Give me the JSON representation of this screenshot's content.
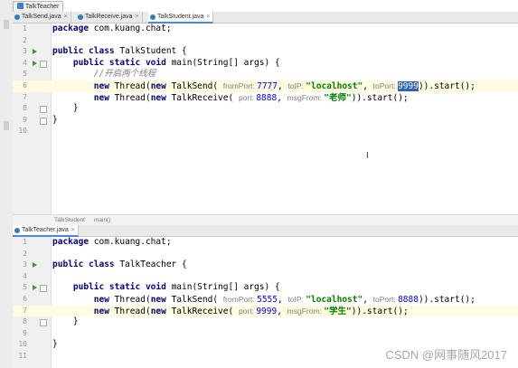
{
  "window": {
    "title": "TalkTeacher"
  },
  "top_tabs": [
    {
      "label": "TalkSend.java",
      "active": false
    },
    {
      "label": "TalkReceive.java",
      "active": false
    },
    {
      "label": "TalkStudent.java",
      "active": true
    }
  ],
  "top_editor": {
    "lines": [
      {
        "n": "1",
        "parts": [
          {
            "t": "package ",
            "c": "kw"
          },
          {
            "t": "com.kuang.chat;",
            "c": ""
          }
        ]
      },
      {
        "n": "2",
        "parts": []
      },
      {
        "n": "3",
        "parts": [
          {
            "t": "public class ",
            "c": "kw"
          },
          {
            "t": "TalkStudent {",
            "c": ""
          }
        ]
      },
      {
        "n": "4",
        "parts": [
          {
            "t": "    public static void ",
            "c": "kw"
          },
          {
            "t": "main(String[] args) {",
            "c": ""
          }
        ]
      },
      {
        "n": "5",
        "parts": [
          {
            "t": "        //开启两个线程",
            "c": "cmt"
          }
        ]
      },
      {
        "n": "6",
        "parts": [
          {
            "t": "        new ",
            "c": "kw"
          },
          {
            "t": "Thread(",
            "c": ""
          },
          {
            "t": "new ",
            "c": "kw"
          },
          {
            "t": "TalkSend( ",
            "c": ""
          },
          {
            "t": "fromPort: ",
            "c": "hint"
          },
          {
            "t": "7777",
            "c": "num"
          },
          {
            "t": ", ",
            "c": ""
          },
          {
            "t": "toIP: ",
            "c": "hint"
          },
          {
            "t": "\"localhost\"",
            "c": "str"
          },
          {
            "t": ", ",
            "c": ""
          },
          {
            "t": "toPort: ",
            "c": "hint"
          },
          {
            "t": "9999",
            "c": "sel"
          },
          {
            "t": ")).start();",
            "c": ""
          }
        ]
      },
      {
        "n": "7",
        "parts": [
          {
            "t": "        new ",
            "c": "kw"
          },
          {
            "t": "Thread(",
            "c": ""
          },
          {
            "t": "new ",
            "c": "kw"
          },
          {
            "t": "TalkReceive( ",
            "c": ""
          },
          {
            "t": "port: ",
            "c": "hint"
          },
          {
            "t": "8888",
            "c": "num"
          },
          {
            "t": ", ",
            "c": ""
          },
          {
            "t": "msgFrom: ",
            "c": "hint"
          },
          {
            "t": "\"老师\"",
            "c": "str"
          },
          {
            "t": ")).start();",
            "c": ""
          }
        ]
      },
      {
        "n": "8",
        "parts": [
          {
            "t": "    }",
            "c": ""
          }
        ]
      },
      {
        "n": "9",
        "parts": [
          {
            "t": "}",
            "c": ""
          }
        ]
      },
      {
        "n": "10",
        "parts": []
      }
    ]
  },
  "breadcrumb": [
    "TalkStudent",
    "main()"
  ],
  "bottom_tabs": [
    {
      "label": "TalkTeacher.java",
      "active": true
    }
  ],
  "bottom_editor": {
    "lines": [
      {
        "n": "1",
        "parts": [
          {
            "t": "package ",
            "c": "kw"
          },
          {
            "t": "com.kuang.chat;",
            "c": ""
          }
        ]
      },
      {
        "n": "2",
        "parts": []
      },
      {
        "n": "3",
        "parts": [
          {
            "t": "public class ",
            "c": "kw"
          },
          {
            "t": "TalkTeacher {",
            "c": ""
          }
        ]
      },
      {
        "n": "4",
        "parts": []
      },
      {
        "n": "5",
        "parts": [
          {
            "t": "    public static void ",
            "c": "kw"
          },
          {
            "t": "main(String[] args) {",
            "c": ""
          }
        ]
      },
      {
        "n": "6",
        "parts": [
          {
            "t": "        new ",
            "c": "kw"
          },
          {
            "t": "Thread(",
            "c": ""
          },
          {
            "t": "new ",
            "c": "kw"
          },
          {
            "t": "TalkSend( ",
            "c": ""
          },
          {
            "t": "fromPort: ",
            "c": "hint"
          },
          {
            "t": "5555",
            "c": "num"
          },
          {
            "t": ", ",
            "c": ""
          },
          {
            "t": "toIP: ",
            "c": "hint"
          },
          {
            "t": "\"localhost\"",
            "c": "str"
          },
          {
            "t": ", ",
            "c": ""
          },
          {
            "t": "toPort: ",
            "c": "hint"
          },
          {
            "t": "8888",
            "c": "num"
          },
          {
            "t": ")).start();",
            "c": ""
          }
        ]
      },
      {
        "n": "7",
        "parts": [
          {
            "t": "        new ",
            "c": "kw"
          },
          {
            "t": "Thread(",
            "c": ""
          },
          {
            "t": "new ",
            "c": "kw"
          },
          {
            "t": "TalkReceive",
            "c": "ulink"
          },
          {
            "t": "( ",
            "c": ""
          },
          {
            "t": "port: ",
            "c": "hint"
          },
          {
            "t": "9999",
            "c": "num"
          },
          {
            "t": ", ",
            "c": ""
          },
          {
            "t": "msgFrom: ",
            "c": "hint"
          },
          {
            "t": "\"学生\"",
            "c": "str"
          },
          {
            "t": ")).start();",
            "c": ""
          }
        ]
      },
      {
        "n": "8",
        "parts": [
          {
            "t": "    }",
            "c": ""
          }
        ]
      },
      {
        "n": "9",
        "parts": []
      },
      {
        "n": "10",
        "parts": [
          {
            "t": "}",
            "c": ""
          }
        ]
      },
      {
        "n": "11",
        "parts": []
      }
    ]
  },
  "cursor": {
    "glyph": "I"
  },
  "watermark": "CSDN @网事随风2017",
  "colors": {
    "keyword": "#000080",
    "string": "#008000",
    "number": "#0000ff",
    "hint": "#808080",
    "selection": "#2f63b8",
    "highlight_line": "#fffbe0"
  }
}
